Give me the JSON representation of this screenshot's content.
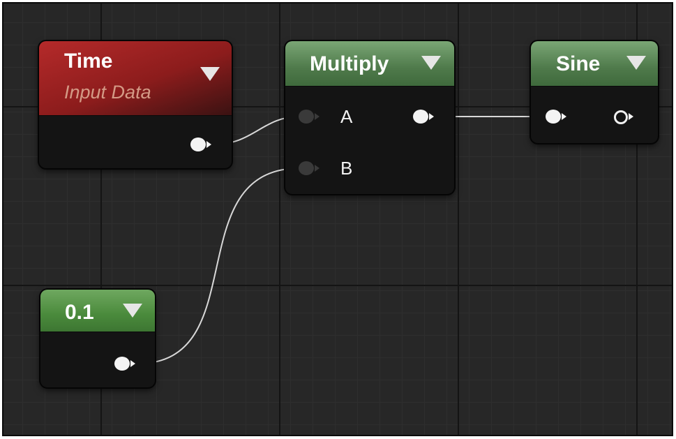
{
  "nodes": {
    "time": {
      "title": "Time",
      "subtitle": "Input Data"
    },
    "multiply": {
      "title": "Multiply",
      "pins": {
        "a": "A",
        "b": "B"
      }
    },
    "sine": {
      "title": "Sine"
    },
    "constant": {
      "title": "0.1"
    }
  },
  "colors": {
    "canvas_bg": "#272727",
    "header_red": "#8c1c1c",
    "header_green": "#4f7a4b",
    "wire": "#d8d8d8",
    "pin_connected": "#f4f4f4",
    "pin_unconnected": "#3a3a3a"
  },
  "icons": {
    "collapse": "chevron-down-icon",
    "output_pin": "exec-pin-icon",
    "empty_output": "ring-pin-icon"
  }
}
